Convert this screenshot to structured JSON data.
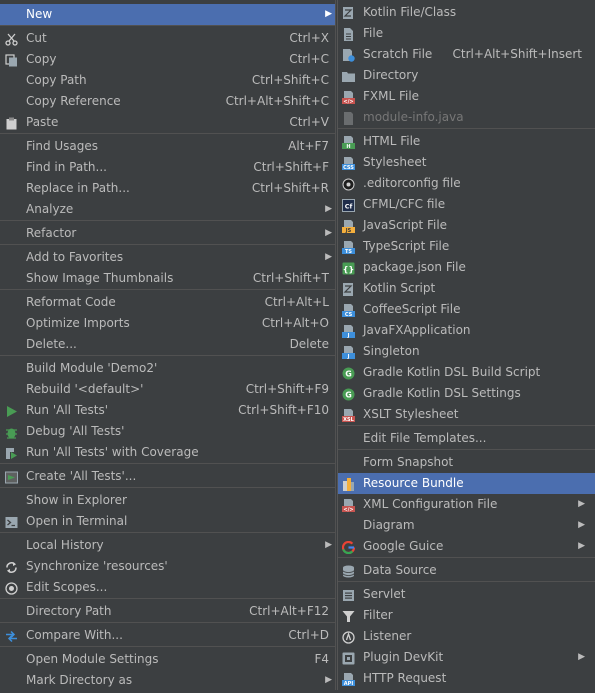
{
  "main_menu": {
    "items": [
      {
        "label": "New",
        "shortcut": "",
        "icon": "",
        "selected": true,
        "submenu": true
      },
      {
        "label": "Cut",
        "shortcut": "Ctrl+X",
        "icon": "scissors-icon"
      },
      {
        "label": "Copy",
        "shortcut": "Ctrl+C",
        "icon": "copy-icon"
      },
      {
        "label": "Copy Path",
        "shortcut": "Ctrl+Shift+C",
        "icon": ""
      },
      {
        "label": "Copy Reference",
        "shortcut": "Ctrl+Alt+Shift+C",
        "icon": ""
      },
      {
        "label": "Paste",
        "shortcut": "Ctrl+V",
        "icon": "clipboard-icon"
      },
      {
        "label": "Find Usages",
        "shortcut": "Alt+F7",
        "icon": ""
      },
      {
        "label": "Find in Path...",
        "shortcut": "Ctrl+Shift+F",
        "icon": ""
      },
      {
        "label": "Replace in Path...",
        "shortcut": "Ctrl+Shift+R",
        "icon": ""
      },
      {
        "label": "Analyze",
        "shortcut": "",
        "icon": "",
        "submenu": true
      },
      {
        "label": "Refactor",
        "shortcut": "",
        "icon": "",
        "submenu": true
      },
      {
        "label": "Add to Favorites",
        "shortcut": "",
        "icon": "",
        "submenu": true
      },
      {
        "label": "Show Image Thumbnails",
        "shortcut": "Ctrl+Shift+T",
        "icon": ""
      },
      {
        "label": "Reformat Code",
        "shortcut": "Ctrl+Alt+L",
        "icon": ""
      },
      {
        "label": "Optimize Imports",
        "shortcut": "Ctrl+Alt+O",
        "icon": ""
      },
      {
        "label": "Delete...",
        "shortcut": "Delete",
        "icon": ""
      },
      {
        "label": "Build Module 'Demo2'",
        "shortcut": "",
        "icon": ""
      },
      {
        "label": "Rebuild '<default>'",
        "shortcut": "Ctrl+Shift+F9",
        "icon": ""
      },
      {
        "label": "Run 'All Tests'",
        "shortcut": "Ctrl+Shift+F10",
        "icon": "run-icon"
      },
      {
        "label": "Debug 'All Tests'",
        "shortcut": "",
        "icon": "debug-icon"
      },
      {
        "label": "Run 'All Tests' with Coverage",
        "shortcut": "",
        "icon": "coverage-icon"
      },
      {
        "label": "Create 'All Tests'...",
        "shortcut": "",
        "icon": "create-config-icon"
      },
      {
        "label": "Show in Explorer",
        "shortcut": "",
        "icon": ""
      },
      {
        "label": "Open in Terminal",
        "shortcut": "",
        "icon": "terminal-icon"
      },
      {
        "label": "Local History",
        "shortcut": "",
        "icon": "",
        "submenu": true
      },
      {
        "label": "Synchronize 'resources'",
        "shortcut": "",
        "icon": "sync-icon"
      },
      {
        "label": "Edit Scopes...",
        "shortcut": "",
        "icon": "scopes-icon"
      },
      {
        "label": "Directory Path",
        "shortcut": "Ctrl+Alt+F12",
        "icon": ""
      },
      {
        "label": "Compare With...",
        "shortcut": "Ctrl+D",
        "icon": "compare-icon"
      },
      {
        "label": "Open Module Settings",
        "shortcut": "F4",
        "icon": ""
      },
      {
        "label": "Mark Directory as",
        "shortcut": "",
        "icon": "",
        "submenu": true
      }
    ]
  },
  "new_submenu": {
    "items": [
      {
        "label": "Kotlin File/Class",
        "shortcut": "",
        "icon": "kotlin-file-icon"
      },
      {
        "label": "File",
        "shortcut": "",
        "icon": "file-icon"
      },
      {
        "label": "Scratch File",
        "shortcut": "Ctrl+Alt+Shift+Insert",
        "icon": "scratch-file-icon"
      },
      {
        "label": "Directory",
        "shortcut": "",
        "icon": "folder-icon"
      },
      {
        "label": "FXML File",
        "shortcut": "",
        "icon": "fxml-file-icon"
      },
      {
        "label": "module-info.java",
        "shortcut": "",
        "icon": "module-info-icon",
        "disabled": true
      },
      {
        "label": "HTML File",
        "shortcut": "",
        "icon": "html-file-icon"
      },
      {
        "label": "Stylesheet",
        "shortcut": "",
        "icon": "css-file-icon"
      },
      {
        "label": ".editorconfig file",
        "shortcut": "",
        "icon": "editorconfig-icon"
      },
      {
        "label": "CFML/CFC file",
        "shortcut": "",
        "icon": "cfml-file-icon"
      },
      {
        "label": "JavaScript File",
        "shortcut": "",
        "icon": "javascript-file-icon"
      },
      {
        "label": "TypeScript File",
        "shortcut": "",
        "icon": "typescript-file-icon"
      },
      {
        "label": "package.json File",
        "shortcut": "",
        "icon": "package-json-icon"
      },
      {
        "label": "Kotlin Script",
        "shortcut": "",
        "icon": "kotlin-script-icon"
      },
      {
        "label": "CoffeeScript File",
        "shortcut": "",
        "icon": "coffeescript-file-icon"
      },
      {
        "label": "JavaFXApplication",
        "shortcut": "",
        "icon": "javafx-icon"
      },
      {
        "label": "Singleton",
        "shortcut": "",
        "icon": "singleton-icon"
      },
      {
        "label": "Gradle Kotlin DSL Build Script",
        "shortcut": "",
        "icon": "gradle-icon"
      },
      {
        "label": "Gradle Kotlin DSL Settings",
        "shortcut": "",
        "icon": "gradle-icon"
      },
      {
        "label": "XSLT Stylesheet",
        "shortcut": "",
        "icon": "xslt-file-icon"
      },
      {
        "label": "Edit File Templates...",
        "shortcut": "",
        "icon": ""
      },
      {
        "label": "Form Snapshot",
        "shortcut": "",
        "icon": ""
      },
      {
        "label": "Resource Bundle",
        "shortcut": "",
        "icon": "resource-bundle-icon",
        "selected": true
      },
      {
        "label": "XML Configuration File",
        "shortcut": "",
        "icon": "xml-config-icon",
        "submenu": true
      },
      {
        "label": "Diagram",
        "shortcut": "",
        "icon": "",
        "submenu": true
      },
      {
        "label": "Google Guice",
        "shortcut": "",
        "icon": "google-icon",
        "submenu": true
      },
      {
        "label": "Data Source",
        "shortcut": "",
        "icon": "database-icon"
      },
      {
        "label": "Servlet",
        "shortcut": "",
        "icon": "servlet-icon"
      },
      {
        "label": "Filter",
        "shortcut": "",
        "icon": "filter-icon"
      },
      {
        "label": "Listener",
        "shortcut": "",
        "icon": "listener-icon"
      },
      {
        "label": "Plugin DevKit",
        "shortcut": "",
        "icon": "plugin-devkit-icon",
        "submenu": true
      },
      {
        "label": "HTTP Request",
        "shortcut": "",
        "icon": "http-request-icon"
      }
    ]
  },
  "arrow_glyph": "▶",
  "colors": {
    "background": "#3c3f41",
    "selection": "#4b6eaf",
    "text": "#bbbbbb",
    "disabled": "#777777",
    "separator": "#515151"
  }
}
